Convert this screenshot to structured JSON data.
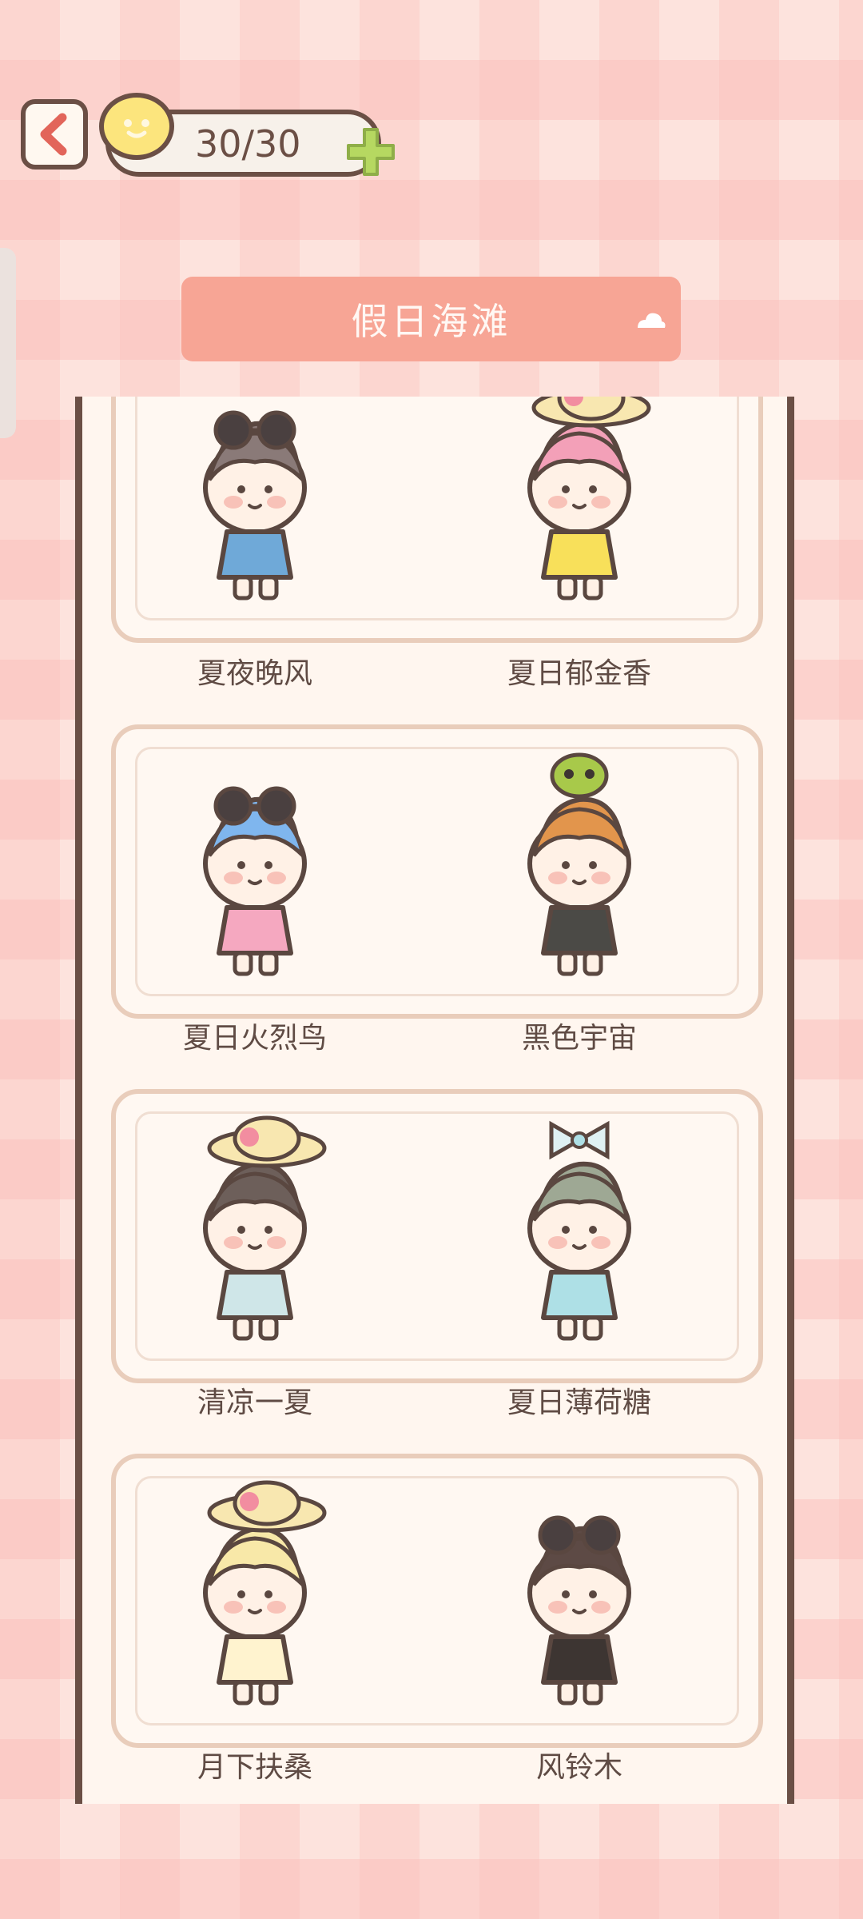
{
  "header": {
    "stamina_value": "30/30"
  },
  "dropdown": {
    "label": "假日海滩"
  },
  "items": [
    {
      "name": "夏夜晚风",
      "hair": "#8a7a78",
      "outfit": "#6fa9d8",
      "accessory": "sunglasses"
    },
    {
      "name": "夏日郁金香",
      "hair": "#f3a0b8",
      "outfit": "#f8e05a",
      "accessory": "hat"
    },
    {
      "name": "夏日火烈鸟",
      "hair": "#7fb6ee",
      "outfit": "#f5a8c0",
      "accessory": "sunglasses"
    },
    {
      "name": "黑色宇宙",
      "hair": "#e2954c",
      "outfit": "#4b4a46",
      "accessory": "alien"
    },
    {
      "name": "清凉一夏",
      "hair": "#6d5f5a",
      "outfit": "#cfe6e8",
      "accessory": "hat"
    },
    {
      "name": "夏日薄荷糖",
      "hair": "#9ea894",
      "outfit": "#aee0e6",
      "accessory": "bow"
    },
    {
      "name": "月下扶桑",
      "hair": "#f8e8a8",
      "outfit": "#fff3cf",
      "accessory": "hat"
    },
    {
      "name": "风铃木",
      "hair": "#5d4a45",
      "outfit": "#3d3532",
      "accessory": "sunglasses"
    }
  ],
  "colors": {
    "accent": "#f7a595",
    "outline": "#6b4f45",
    "panel": "#fff6ef"
  }
}
